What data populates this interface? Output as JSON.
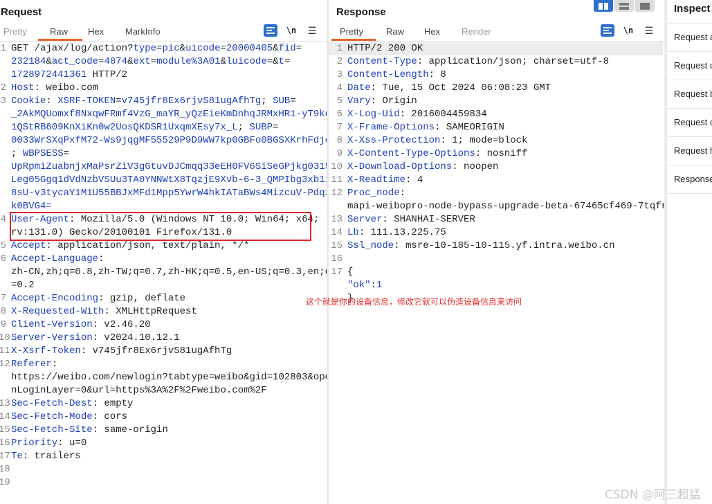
{
  "request": {
    "title": "Request",
    "tabs": [
      "Pretty",
      "Raw",
      "Hex",
      "MarkInfo"
    ],
    "active_tab": "Raw",
    "lines": [
      {
        "n": "1",
        "parts": [
          [
            "t",
            "GET /ajax/log/action?"
          ],
          [
            "k",
            "type"
          ],
          [
            "t",
            "="
          ],
          [
            "k",
            "pic"
          ],
          [
            "t",
            "&"
          ],
          [
            "k",
            "uicode"
          ],
          [
            "t",
            "="
          ],
          [
            "k",
            "20000405"
          ],
          [
            "t",
            "&"
          ],
          [
            "k",
            "fid"
          ],
          [
            "t",
            "="
          ]
        ]
      },
      {
        "n": "",
        "parts": [
          [
            "k",
            "232184"
          ],
          [
            "t",
            "&"
          ],
          [
            "k",
            "act_code"
          ],
          [
            "t",
            "="
          ],
          [
            "k",
            "4874"
          ],
          [
            "t",
            "&"
          ],
          [
            "k",
            "ext"
          ],
          [
            "t",
            "="
          ],
          [
            "k",
            "module%3A01"
          ],
          [
            "t",
            "&"
          ],
          [
            "k",
            "luicode"
          ],
          [
            "t",
            "=&"
          ],
          [
            "k",
            "t"
          ],
          [
            "t",
            "="
          ]
        ]
      },
      {
        "n": "",
        "parts": [
          [
            "k",
            "1728972441361"
          ],
          [
            "t",
            " HTTP/2"
          ]
        ]
      },
      {
        "n": "2",
        "parts": [
          [
            "k",
            "Host"
          ],
          [
            "t",
            ": weibo.com"
          ]
        ]
      },
      {
        "n": "3",
        "parts": [
          [
            "k",
            "Cookie"
          ],
          [
            "t",
            ": "
          ],
          [
            "k",
            "XSRF-TOKEN"
          ],
          [
            "t",
            "="
          ],
          [
            "k",
            "v745jfr8Ex6rjvS81ugAfhTg"
          ],
          [
            "t",
            "; "
          ],
          [
            "k",
            "SUB"
          ],
          [
            "t",
            "="
          ]
        ]
      },
      {
        "n": "",
        "parts": [
          [
            "k",
            "_2AkMQUomxf8NxqwFRmf4VzG_maYR_yQzEieKmDnhqJRMxHR1-yT9kq"
          ]
        ]
      },
      {
        "n": "",
        "parts": [
          [
            "k",
            "1QStRB609KnXiKn0w2UosQKDSR1UxqmXEsy7x_L"
          ],
          [
            "t",
            "; "
          ],
          [
            "k",
            "SUBP"
          ],
          [
            "t",
            "="
          ]
        ]
      },
      {
        "n": "",
        "parts": [
          [
            "k",
            "0033WrSXqPxfM72-Ws9jqgMF55529P9D9WW7kp0GBFo0BGSXKrhFdjo"
          ]
        ]
      },
      {
        "n": "",
        "parts": [
          [
            "t",
            "; "
          ],
          [
            "k",
            "WBPSESS"
          ],
          [
            "t",
            "="
          ]
        ]
      },
      {
        "n": "",
        "parts": [
          [
            "k",
            "UpRpmiZuabnjxMaPsrZiV3gGtuvDJCmqq33eEH0FV6SiSeGPjkg0315"
          ]
        ]
      },
      {
        "n": "",
        "parts": [
          [
            "k",
            "Leg05Ggq1dVdNzbVSUu3TA0YNNWtX8TqzjE9Xvb-6-3_QMPIbg3xb1i"
          ]
        ]
      },
      {
        "n": "",
        "parts": [
          [
            "k",
            "8sU-v3tycaY1M1U55BBJxMFd1Mpp5YwrW4hkIATaBWs4MizcuV-Pdqz"
          ]
        ]
      },
      {
        "n": "",
        "parts": [
          [
            "k",
            "k0BVG4="
          ]
        ]
      },
      {
        "n": "4",
        "parts": [
          [
            "k",
            "User-Agent"
          ],
          [
            "t",
            ": Mozilla/5.0 (Windows NT 10.0; Win64; x64;"
          ]
        ]
      },
      {
        "n": "",
        "parts": [
          [
            "t",
            "rv:131.0) Gecko/20100101 Firefox/131.0"
          ]
        ]
      },
      {
        "n": "5",
        "parts": [
          [
            "k",
            "Accept"
          ],
          [
            "t",
            ": application/json, text/plain, */*"
          ]
        ]
      },
      {
        "n": "6",
        "parts": [
          [
            "k",
            "Accept-Language"
          ],
          [
            "t",
            ":"
          ]
        ]
      },
      {
        "n": "",
        "parts": [
          [
            "t",
            "zh-CN,zh;q=0.8,zh-TW;q=0.7,zh-HK;q=0.5,en-US;q=0.3,en;q"
          ]
        ]
      },
      {
        "n": "",
        "parts": [
          [
            "t",
            "=0.2"
          ]
        ]
      },
      {
        "n": "7",
        "parts": [
          [
            "k",
            "Accept-Encoding"
          ],
          [
            "t",
            ": gzip, deflate"
          ]
        ]
      },
      {
        "n": "8",
        "parts": [
          [
            "k",
            "X-Requested-With"
          ],
          [
            "t",
            ": XMLHttpRequest"
          ]
        ]
      },
      {
        "n": "9",
        "parts": [
          [
            "k",
            "Client-Version"
          ],
          [
            "t",
            ": v2.46.20"
          ]
        ]
      },
      {
        "n": "10",
        "parts": [
          [
            "k",
            "Server-Version"
          ],
          [
            "t",
            ": v2024.10.12.1"
          ]
        ]
      },
      {
        "n": "11",
        "parts": [
          [
            "k",
            "X-Xsrf-Token"
          ],
          [
            "t",
            ": v745jfr8Ex6rjvS81ugAfhTg"
          ]
        ]
      },
      {
        "n": "12",
        "parts": [
          [
            "k",
            "Referer"
          ],
          [
            "t",
            ":"
          ]
        ]
      },
      {
        "n": "",
        "parts": [
          [
            "t",
            "https://weibo.com/newlogin?tabtype=weibo&gid=102803&ope"
          ]
        ]
      },
      {
        "n": "",
        "parts": [
          [
            "t",
            "nLoginLayer=0&url=https%3A%2F%2Fweibo.com%2F"
          ]
        ]
      },
      {
        "n": "13",
        "parts": [
          [
            "k",
            "Sec-Fetch-Dest"
          ],
          [
            "t",
            ": empty"
          ]
        ]
      },
      {
        "n": "14",
        "parts": [
          [
            "k",
            "Sec-Fetch-Mode"
          ],
          [
            "t",
            ": cors"
          ]
        ]
      },
      {
        "n": "15",
        "parts": [
          [
            "k",
            "Sec-Fetch-Site"
          ],
          [
            "t",
            ": same-origin"
          ]
        ]
      },
      {
        "n": "16",
        "parts": [
          [
            "k",
            "Priority"
          ],
          [
            "t",
            ": u=0"
          ]
        ]
      },
      {
        "n": "17",
        "parts": [
          [
            "k",
            "Te"
          ],
          [
            "t",
            ": trailers"
          ]
        ]
      },
      {
        "n": "18",
        "parts": []
      },
      {
        "n": "19",
        "parts": []
      }
    ]
  },
  "response": {
    "title": "Response",
    "tabs": [
      "Pretty",
      "Raw",
      "Hex",
      "Render"
    ],
    "active_tab": "Pretty",
    "lines": [
      {
        "n": "1",
        "parts": [
          [
            "t",
            "HTTP/2 200 OK"
          ]
        ]
      },
      {
        "n": "2",
        "parts": [
          [
            "k",
            "Content-Type"
          ],
          [
            "t",
            ": application/json; charset=utf-8"
          ]
        ]
      },
      {
        "n": "3",
        "parts": [
          [
            "k",
            "Content-Length"
          ],
          [
            "t",
            ": 8"
          ]
        ]
      },
      {
        "n": "4",
        "parts": [
          [
            "k",
            "Date"
          ],
          [
            "t",
            ": Tue, 15 Oct 2024 06:08:23 GMT"
          ]
        ]
      },
      {
        "n": "5",
        "parts": [
          [
            "k",
            "Vary"
          ],
          [
            "t",
            ": Origin"
          ]
        ]
      },
      {
        "n": "6",
        "parts": [
          [
            "k",
            "X-Log-Uid"
          ],
          [
            "t",
            ": 2016004459834"
          ]
        ]
      },
      {
        "n": "7",
        "parts": [
          [
            "k",
            "X-Frame-Options"
          ],
          [
            "t",
            ": SAMEORIGIN"
          ]
        ]
      },
      {
        "n": "8",
        "parts": [
          [
            "k",
            "X-Xss-Protection"
          ],
          [
            "t",
            ": 1; mode=block"
          ]
        ]
      },
      {
        "n": "9",
        "parts": [
          [
            "k",
            "X-Content-Type-Options"
          ],
          [
            "t",
            ": nosniff"
          ]
        ]
      },
      {
        "n": "10",
        "parts": [
          [
            "k",
            "X-Download-Options"
          ],
          [
            "t",
            ": noopen"
          ]
        ]
      },
      {
        "n": "11",
        "parts": [
          [
            "k",
            "X-Readtime"
          ],
          [
            "t",
            ": 4"
          ]
        ]
      },
      {
        "n": "12",
        "parts": [
          [
            "k",
            "Proc_node"
          ],
          [
            "t",
            ":"
          ]
        ]
      },
      {
        "n": "",
        "parts": [
          [
            "t",
            "mapi-weibopro-node-bypass-upgrade-beta-67465cf469-7tqfr"
          ]
        ]
      },
      {
        "n": "13",
        "parts": [
          [
            "k",
            "Server"
          ],
          [
            "t",
            ": SHANHAI-SERVER"
          ]
        ]
      },
      {
        "n": "14",
        "parts": [
          [
            "k",
            "Lb"
          ],
          [
            "t",
            ": 111.13.225.75"
          ]
        ]
      },
      {
        "n": "15",
        "parts": [
          [
            "k",
            "Ssl_node"
          ],
          [
            "t",
            ": msre-10-185-10-115.yf.intra.weibo.cn"
          ]
        ]
      },
      {
        "n": "16",
        "parts": []
      },
      {
        "n": "17",
        "parts": [
          [
            "t",
            "{"
          ]
        ]
      },
      {
        "n": "",
        "parts": [
          [
            "t",
            "  "
          ],
          [
            "k",
            "\"ok\""
          ],
          [
            "t",
            ":"
          ],
          [
            "k",
            "1"
          ]
        ]
      },
      {
        "n": "",
        "parts": [
          [
            "t",
            "}"
          ]
        ]
      }
    ]
  },
  "annotation": "这个就是你的设备信息，修改它就可以伪造设备信息来访问",
  "inspector": {
    "title": "Inspect",
    "items": [
      "Request a",
      "Request q",
      "Request b",
      "Request c",
      "Request h",
      "Response"
    ]
  },
  "watermark": "CSDN @阿三超猛",
  "colors": {
    "key": "#1b3fb8",
    "accent": "#e8632a",
    "annotation": "#d8262c",
    "button": "#2f6fd0"
  }
}
